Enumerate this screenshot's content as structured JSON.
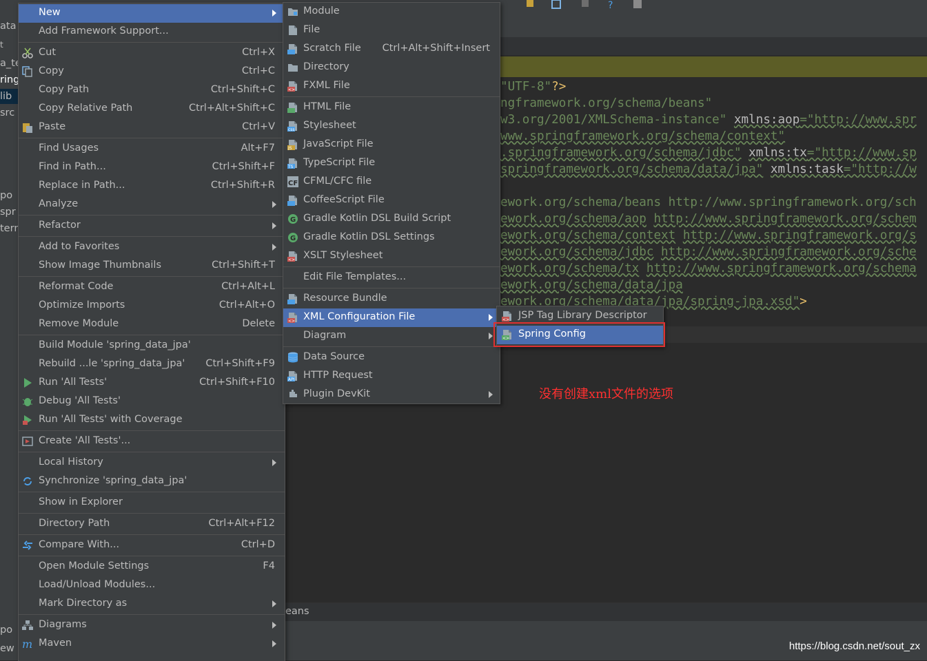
{
  "context_menu": {
    "items": [
      {
        "label": "New",
        "shortcut": "",
        "submenu": true,
        "icon": null,
        "selected": true
      },
      {
        "label": "Add Framework Support...",
        "shortcut": "",
        "submenu": false,
        "icon": null
      },
      {
        "label": "Cut",
        "shortcut": "Ctrl+X",
        "submenu": false,
        "icon": "scissors-icon"
      },
      {
        "label": "Copy",
        "shortcut": "Ctrl+C",
        "submenu": false,
        "icon": "copy-icon"
      },
      {
        "label": "Copy Path",
        "shortcut": "Ctrl+Shift+C",
        "submenu": false,
        "icon": null
      },
      {
        "label": "Copy Relative Path",
        "shortcut": "Ctrl+Alt+Shift+C",
        "submenu": false,
        "icon": null
      },
      {
        "label": "Paste",
        "shortcut": "Ctrl+V",
        "submenu": false,
        "icon": "paste-icon"
      },
      {
        "label": "Find Usages",
        "shortcut": "Alt+F7",
        "submenu": false,
        "icon": null
      },
      {
        "label": "Find in Path...",
        "shortcut": "Ctrl+Shift+F",
        "submenu": false,
        "icon": null
      },
      {
        "label": "Replace in Path...",
        "shortcut": "Ctrl+Shift+R",
        "submenu": false,
        "icon": null
      },
      {
        "label": "Analyze",
        "shortcut": "",
        "submenu": true,
        "icon": null
      },
      {
        "label": "Refactor",
        "shortcut": "",
        "submenu": true,
        "icon": null
      },
      {
        "label": "Add to Favorites",
        "shortcut": "",
        "submenu": true,
        "icon": null
      },
      {
        "label": "Show Image Thumbnails",
        "shortcut": "Ctrl+Shift+T",
        "submenu": false,
        "icon": null
      },
      {
        "label": "Reformat Code",
        "shortcut": "Ctrl+Alt+L",
        "submenu": false,
        "icon": null
      },
      {
        "label": "Optimize Imports",
        "shortcut": "Ctrl+Alt+O",
        "submenu": false,
        "icon": null
      },
      {
        "label": "Remove Module",
        "shortcut": "Delete",
        "submenu": false,
        "icon": null
      },
      {
        "label": "Build Module 'spring_data_jpa'",
        "shortcut": "",
        "submenu": false,
        "icon": null
      },
      {
        "label": "Rebuild ...le 'spring_data_jpa'",
        "shortcut": "Ctrl+Shift+F9",
        "submenu": false,
        "icon": null
      },
      {
        "label": "Run 'All Tests'",
        "shortcut": "Ctrl+Shift+F10",
        "submenu": false,
        "icon": "run-icon"
      },
      {
        "label": "Debug 'All Tests'",
        "shortcut": "",
        "submenu": false,
        "icon": "debug-icon"
      },
      {
        "label": "Run 'All Tests' with Coverage",
        "shortcut": "",
        "submenu": false,
        "icon": "coverage-icon"
      },
      {
        "label": "Create 'All Tests'...",
        "shortcut": "",
        "submenu": false,
        "icon": "create-config-icon"
      },
      {
        "label": "Local History",
        "shortcut": "",
        "submenu": true,
        "icon": null
      },
      {
        "label": "Synchronize 'spring_data_jpa'",
        "shortcut": "",
        "submenu": false,
        "icon": "sync-icon"
      },
      {
        "label": "Show in Explorer",
        "shortcut": "",
        "submenu": false,
        "icon": null
      },
      {
        "label": "Directory Path",
        "shortcut": "Ctrl+Alt+F12",
        "submenu": false,
        "icon": null
      },
      {
        "label": "Compare With...",
        "shortcut": "Ctrl+D",
        "submenu": false,
        "icon": "compare-icon"
      },
      {
        "label": "Open Module Settings",
        "shortcut": "F4",
        "submenu": false,
        "icon": null
      },
      {
        "label": "Load/Unload Modules...",
        "shortcut": "",
        "submenu": false,
        "icon": null
      },
      {
        "label": "Mark Directory as",
        "shortcut": "",
        "submenu": true,
        "icon": null
      },
      {
        "label": "Diagrams",
        "shortcut": "",
        "submenu": true,
        "icon": "diagrams-icon"
      },
      {
        "label": "Maven",
        "shortcut": "",
        "submenu": true,
        "icon": "maven-icon"
      }
    ]
  },
  "new_submenu": {
    "items": [
      {
        "label": "Module",
        "shortcut": "",
        "submenu": false,
        "icon": "module-icon"
      },
      {
        "label": "File",
        "shortcut": "",
        "submenu": false,
        "icon": "file-icon"
      },
      {
        "label": "Scratch File",
        "shortcut": "Ctrl+Alt+Shift+Insert",
        "submenu": false,
        "icon": "scratch-file-icon"
      },
      {
        "label": "Directory",
        "shortcut": "",
        "submenu": false,
        "icon": "folder-icon"
      },
      {
        "label": "FXML File",
        "shortcut": "",
        "submenu": false,
        "icon": "fxml-file-icon"
      },
      {
        "label": "HTML File",
        "shortcut": "",
        "submenu": false,
        "icon": "html-file-icon"
      },
      {
        "label": "Stylesheet",
        "shortcut": "",
        "submenu": false,
        "icon": "css-file-icon"
      },
      {
        "label": "JavaScript File",
        "shortcut": "",
        "submenu": false,
        "icon": "js-file-icon"
      },
      {
        "label": "TypeScript File",
        "shortcut": "",
        "submenu": false,
        "icon": "ts-file-icon"
      },
      {
        "label": "CFML/CFC file",
        "shortcut": "",
        "submenu": false,
        "icon": "cfml-file-icon"
      },
      {
        "label": "CoffeeScript File",
        "shortcut": "",
        "submenu": false,
        "icon": "coffeescript-file-icon"
      },
      {
        "label": "Gradle Kotlin DSL Build Script",
        "shortcut": "",
        "submenu": false,
        "icon": "gradle-icon"
      },
      {
        "label": "Gradle Kotlin DSL Settings",
        "shortcut": "",
        "submenu": false,
        "icon": "gradle-icon"
      },
      {
        "label": "XSLT Stylesheet",
        "shortcut": "",
        "submenu": false,
        "icon": "xslt-file-icon"
      },
      {
        "label": "Edit File Templates...",
        "shortcut": "",
        "submenu": false,
        "icon": null
      },
      {
        "label": "Resource Bundle",
        "shortcut": "",
        "submenu": false,
        "icon": "resource-bundle-icon"
      },
      {
        "label": "XML Configuration File",
        "shortcut": "",
        "submenu": true,
        "icon": "xml-file-icon",
        "selected": true
      },
      {
        "label": "Diagram",
        "shortcut": "",
        "submenu": true,
        "icon": null
      },
      {
        "label": "Data Source",
        "shortcut": "",
        "submenu": false,
        "icon": "database-icon"
      },
      {
        "label": "HTTP Request",
        "shortcut": "",
        "submenu": false,
        "icon": "api-icon"
      },
      {
        "label": "Plugin DevKit",
        "shortcut": "",
        "submenu": true,
        "icon": "plugin-icon"
      }
    ]
  },
  "xml_submenu": {
    "items": [
      {
        "label": "JSP Tag Library Descriptor",
        "icon": "tld-file-icon"
      },
      {
        "label": "Spring Config",
        "icon": "spring-config-icon",
        "selected": true
      }
    ]
  },
  "annotation": "没有创建xml文件的选项",
  "watermark": "https://blog.csdn.net/sout_zx",
  "bottom_breadcrumb": "eans",
  "left_strip": [
    "ata",
    "t",
    "a_te",
    "ring",
    "lib",
    "src",
    "po",
    "spr",
    "tern",
    "po",
    "ew"
  ],
  "editor_lines": [
    {
      "segments": [
        {
          "t": "\"UTF-8\"",
          "c": "str"
        },
        {
          "t": "?>",
          "c": "tag"
        }
      ]
    },
    {
      "segments": [
        {
          "t": "ngframework.org/schema/beans\"",
          "c": "str"
        }
      ]
    },
    {
      "segments": [
        {
          "t": "w3.org/2001/XMLSchema-instance\"",
          "c": "str"
        },
        {
          "t": " ",
          "c": "plain"
        },
        {
          "t": "xmlns:aop",
          "c": "attr"
        },
        {
          "t": "=\"http://www.spr",
          "c": "url"
        }
      ]
    },
    {
      "segments": [
        {
          "t": "www.springframework.org/schema/context\"",
          "c": "url"
        }
      ]
    },
    {
      "segments": [
        {
          "t": ".springframework.org/schema/jdbc\"",
          "c": "url"
        },
        {
          "t": " ",
          "c": "plain"
        },
        {
          "t": "xmlns:tx",
          "c": "attr"
        },
        {
          "t": "=\"http://www.sp",
          "c": "url"
        }
      ]
    },
    {
      "segments": [
        {
          "t": "springframework.org/schema/data/jpa\"",
          "c": "url"
        },
        {
          "t": " ",
          "c": "plain"
        },
        {
          "t": "xmlns:task",
          "c": "attr"
        },
        {
          "t": "=\"http://w",
          "c": "url"
        }
      ]
    },
    {
      "segments": []
    },
    {
      "segments": [
        {
          "t": "ework.org/schema/beans http://www.springframework.org/sch",
          "c": "str"
        }
      ]
    },
    {
      "segments": [
        {
          "t": "ework.org/schema/aop",
          "c": "url"
        },
        {
          "t": " ",
          "c": "plain"
        },
        {
          "t": "http://www.springframework.org/schem",
          "c": "url"
        }
      ]
    },
    {
      "segments": [
        {
          "t": "ework.org/schema/context",
          "c": "url"
        },
        {
          "t": " ",
          "c": "plain"
        },
        {
          "t": "http://www.springframework.org/s",
          "c": "url"
        }
      ]
    },
    {
      "segments": [
        {
          "t": "ework.org/schema/jdbc",
          "c": "url"
        },
        {
          "t": " ",
          "c": "plain"
        },
        {
          "t": "http://www.springframework.org/sche",
          "c": "url"
        }
      ]
    },
    {
      "segments": [
        {
          "t": "ework.org/schema/tx",
          "c": "url"
        },
        {
          "t": " ",
          "c": "plain"
        },
        {
          "t": "http://www.springframework.org/schema",
          "c": "url"
        }
      ]
    },
    {
      "segments": [
        {
          "t": "ework.org/schema/data/jpa",
          "c": "url"
        }
      ]
    },
    {
      "segments": [
        {
          "t": "ework.org/schema/data/jpa/spring-jpa.xsd\"",
          "c": "url"
        },
        {
          "t": ">",
          "c": "tag"
        }
      ]
    }
  ],
  "colors": {
    "menu_bg": "#3c3f41",
    "selection": "#4b6eaf",
    "editor_bg": "#2b2b2b",
    "string": "#6a8759",
    "tag": "#e8bf6a",
    "annotation": "#ff3030",
    "highlight_box": "#e03030"
  }
}
